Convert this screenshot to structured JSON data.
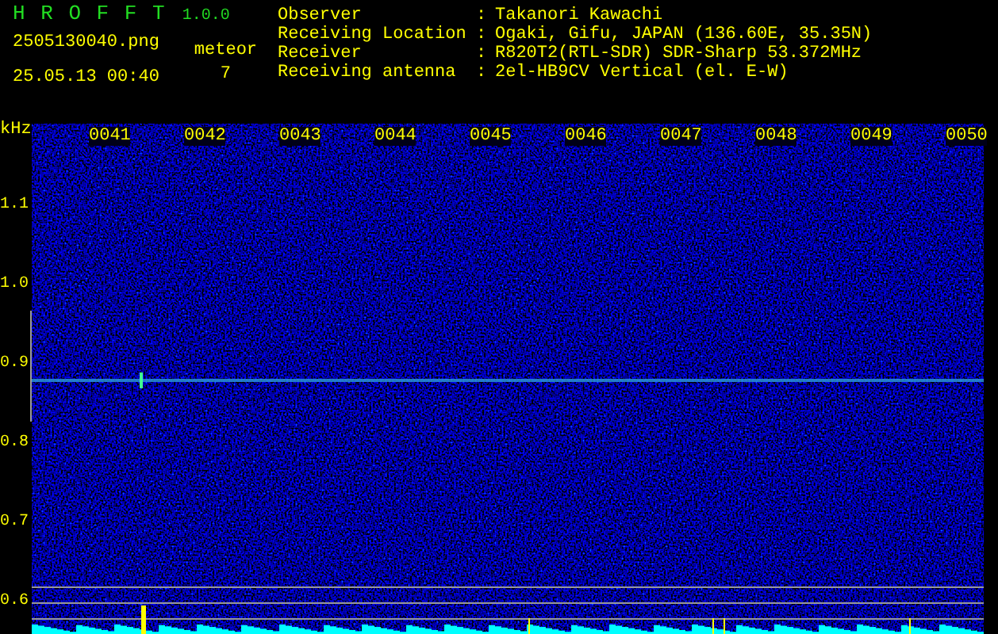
{
  "header": {
    "app_name": "H R O F F T",
    "version": "1.0.0",
    "filename": "2505130040.png",
    "datetime": "25.05.13 00:40",
    "meteor_label": "meteor",
    "meteor_count": "7"
  },
  "info": [
    {
      "label": "Observer",
      "separator": ":",
      "value": "Takanori Kawachi"
    },
    {
      "label": "Receiving Location",
      "separator": ":",
      "value": "Ogaki, Gifu, JAPAN (136.60E, 35.35N)"
    },
    {
      "label": "Receiver",
      "separator": ":",
      "value": "R820T2(RTL-SDR) SDR-Sharp 53.372MHz"
    },
    {
      "label": "Receiving antenna",
      "separator": ":",
      "value": "2el-HB9CV Vertical (el. E-W)"
    }
  ],
  "spectrogram": {
    "unit": "kHz",
    "time_labels": [
      "0041",
      "0042",
      "0043",
      "0044",
      "0045",
      "0046",
      "0047",
      "0048",
      "0049",
      "0050"
    ],
    "freq_labels": [
      "1.1",
      "1.0",
      "0.9",
      "0.8",
      "0.7",
      "0.6"
    ]
  }
}
